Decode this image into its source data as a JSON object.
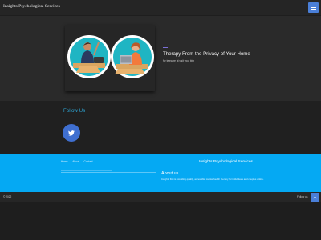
{
  "header": {
    "brand": "Insights Psychological Services",
    "menu_icon": "hamburger-icon",
    "menu_color": "#4a7fd8"
  },
  "hero": {
    "title": "Therapy From the Privacy of Your Home",
    "subtitle": "for telecare at visit your bbb",
    "accent_color": "#7b6fd8"
  },
  "follow": {
    "title": "Follow Us",
    "social_icon": "twitter-icon",
    "button_color": "#3f6fd0"
  },
  "footer": {
    "links": [
      "Home",
      "About",
      "Contact"
    ],
    "brand": "Insights Psychological Services",
    "about_title": "About us",
    "about_text": "Insights first is providing quality, accessible mental health therapy for individuals and couples online.",
    "background_color": "#05a9f3"
  },
  "bottom_bar": {
    "copyright": "© 2022",
    "follow_label": "Follow us",
    "scroll_icon": "chevron-up-icon"
  }
}
